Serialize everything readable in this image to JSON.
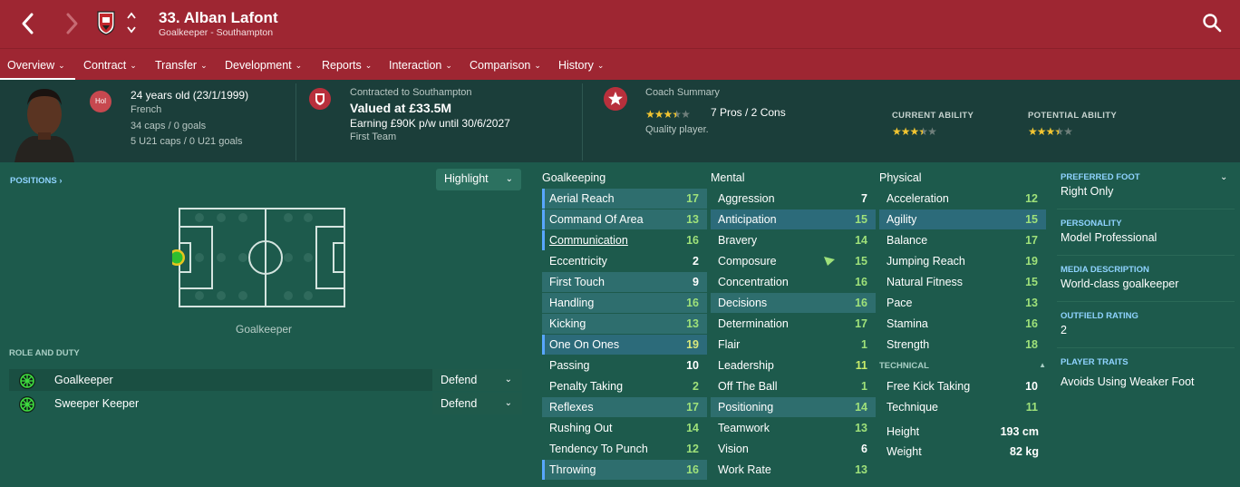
{
  "header": {
    "title": "33. Alban Lafont",
    "subtitle": "Goalkeeper - Southampton"
  },
  "menu": [
    {
      "label": "Overview"
    },
    {
      "label": "Contract"
    },
    {
      "label": "Transfer"
    },
    {
      "label": "Development"
    },
    {
      "label": "Reports"
    },
    {
      "label": "Interaction"
    },
    {
      "label": "Comparison"
    },
    {
      "label": "History"
    }
  ],
  "info": {
    "nationality_badge": "Hol",
    "age": "24 years old (23/1/1999)",
    "nationality": "French",
    "caps": "34 caps / 0 goals",
    "u21_caps": "5 U21 caps / 0 U21 goals",
    "contract_line": "Contracted to Southampton",
    "value": "Valued at £33.5M",
    "earning": "Earning £90K p/w until 30/6/2027",
    "squad": "First Team",
    "coach_summary_label": "Coach Summary",
    "coach_rating": 3.5,
    "pros_cons": "7 Pros / 2 Cons",
    "coach_note": "Quality player.",
    "current_ability_label": "CURRENT ABILITY",
    "current_ability": 3.5,
    "potential_ability_label": "POTENTIAL ABILITY",
    "potential_ability": 3.5
  },
  "positions": {
    "label": "POSITIONS",
    "highlight_label": "Highlight",
    "pitch_label": "Goalkeeper"
  },
  "roles": {
    "label": "ROLE AND DUTY",
    "items": [
      {
        "name": "Goalkeeper",
        "duty": "Defend"
      },
      {
        "name": "Sweeper Keeper",
        "duty": "Defend"
      }
    ]
  },
  "attributes": {
    "goalkeeping": {
      "title": "Goalkeeping",
      "rows": [
        {
          "label": "Aerial Reach",
          "value": "17"
        },
        {
          "label": "Command Of Area",
          "value": "13"
        },
        {
          "label": "Communication",
          "value": "16"
        },
        {
          "label": "Eccentricity",
          "value": "2"
        },
        {
          "label": "First Touch",
          "value": "9"
        },
        {
          "label": "Handling",
          "value": "16"
        },
        {
          "label": "Kicking",
          "value": "13"
        },
        {
          "label": "One On Ones",
          "value": "19"
        },
        {
          "label": "Passing",
          "value": "10"
        },
        {
          "label": "Penalty Taking",
          "value": "2"
        },
        {
          "label": "Reflexes",
          "value": "17"
        },
        {
          "label": "Rushing Out",
          "value": "14"
        },
        {
          "label": "Tendency To Punch",
          "value": "12"
        },
        {
          "label": "Throwing",
          "value": "16"
        }
      ]
    },
    "mental": {
      "title": "Mental",
      "rows": [
        {
          "label": "Aggression",
          "value": "7"
        },
        {
          "label": "Anticipation",
          "value": "15"
        },
        {
          "label": "Bravery",
          "value": "14"
        },
        {
          "label": "Composure",
          "value": "15"
        },
        {
          "label": "Concentration",
          "value": "16"
        },
        {
          "label": "Decisions",
          "value": "16"
        },
        {
          "label": "Determination",
          "value": "17"
        },
        {
          "label": "Flair",
          "value": "1"
        },
        {
          "label": "Leadership",
          "value": "11"
        },
        {
          "label": "Off The Ball",
          "value": "1"
        },
        {
          "label": "Positioning",
          "value": "14"
        },
        {
          "label": "Teamwork",
          "value": "13"
        },
        {
          "label": "Vision",
          "value": "6"
        },
        {
          "label": "Work Rate",
          "value": "13"
        }
      ]
    },
    "physical": {
      "title": "Physical",
      "rows": [
        {
          "label": "Acceleration",
          "value": "12"
        },
        {
          "label": "Agility",
          "value": "15"
        },
        {
          "label": "Balance",
          "value": "17"
        },
        {
          "label": "Jumping Reach",
          "value": "19"
        },
        {
          "label": "Natural Fitness",
          "value": "15"
        },
        {
          "label": "Pace",
          "value": "13"
        },
        {
          "label": "Stamina",
          "value": "16"
        },
        {
          "label": "Strength",
          "value": "18"
        }
      ],
      "technical_title": "TECHNICAL",
      "technical_rows": [
        {
          "label": "Free Kick Taking",
          "value": "10"
        },
        {
          "label": "Technique",
          "value": "11"
        }
      ],
      "height_label": "Height",
      "height": "193 cm",
      "weight_label": "Weight",
      "weight": "82 kg"
    }
  },
  "profile": {
    "preferred_foot_label": "PREFERRED FOOT",
    "preferred_foot": "Right Only",
    "personality_label": "PERSONALITY",
    "personality": "Model Professional",
    "media_label": "MEDIA DESCRIPTION",
    "media": "World-class goalkeeper",
    "outfield_label": "OUTFIELD RATING",
    "outfield": "2",
    "traits_label": "PLAYER TRAITS",
    "traits": "Avoids Using Weaker Foot"
  },
  "colors": {
    "header_red": "#9e2632",
    "panel_green": "#1d5a4c",
    "strip_dark": "#1b3e3a",
    "accent_blue": "#8fd3ff",
    "star_gold": "#f2c531"
  }
}
